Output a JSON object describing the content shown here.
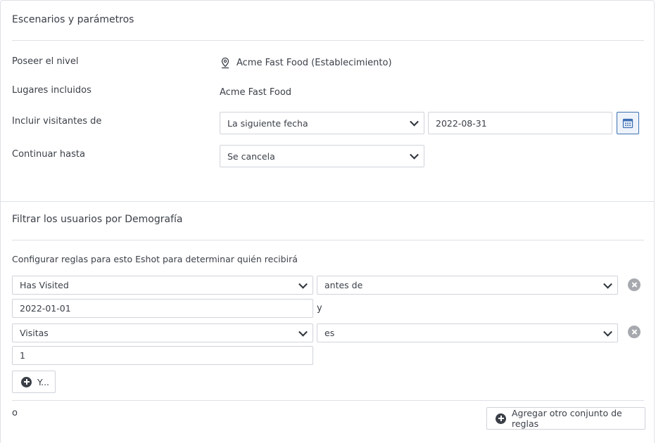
{
  "scenarios": {
    "title": "Escenarios y parámetros",
    "own_level_label": "Poseer el nivel",
    "own_level_value": "Acme Fast Food (Establecimiento)",
    "places_label": "Lugares incluidos",
    "places_value": "Acme Fast Food",
    "include_visitors_label": "Incluir visitantes de",
    "include_visitors_select": "La siguiente fecha",
    "include_visitors_date": "2022-08-31",
    "continue_label": "Continuar hasta",
    "continue_select": "Se cancela"
  },
  "demography": {
    "title": "Filtrar los usuarios por Demografía",
    "description": "Configurar reglas para esto Eshot para determinar quién recibirá",
    "rules": [
      {
        "field": "Has Visited",
        "operator": "antes de",
        "value": "2022-01-01",
        "joiner": "y"
      },
      {
        "field": "Visitas",
        "operator": "es",
        "value": "1"
      }
    ],
    "and_button": "Y...",
    "or_label": "o",
    "add_ruleset_button": "Agregar otro conjunto de reglas"
  },
  "icons": {
    "location": "location-pin-icon",
    "calendar": "calendar-icon",
    "remove": "remove-circle-icon",
    "add": "plus-circle-icon"
  }
}
